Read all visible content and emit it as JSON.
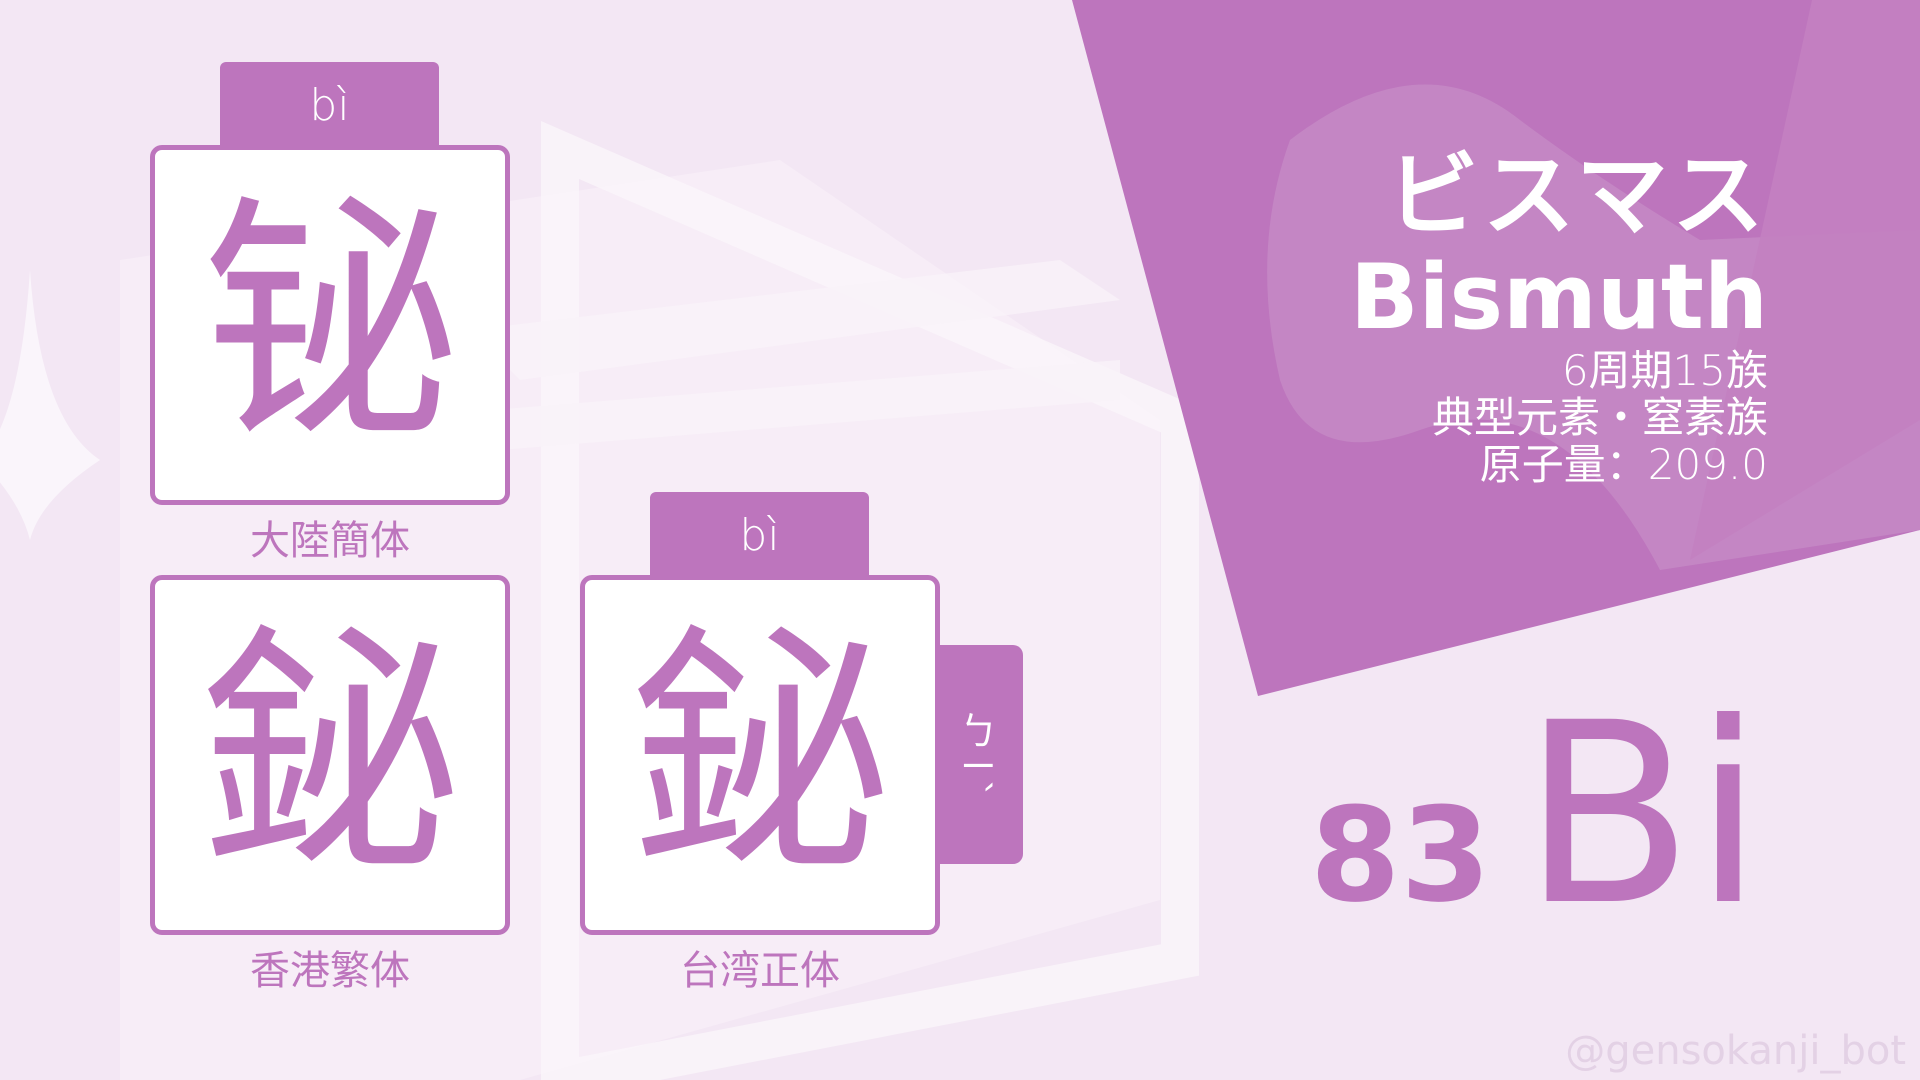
{
  "theme": {
    "accent": "#bd75bd",
    "background": "#f3e7f4",
    "card_bg": "#ffffff"
  },
  "cards": {
    "simplified": {
      "kanji": "铋",
      "pinyin": "bì",
      "label": "大陸簡体"
    },
    "hongkong": {
      "kanji": "鉍",
      "label": "香港繁体"
    },
    "taiwan": {
      "kanji": "鉍",
      "pinyin": "bì",
      "bopomofo": "ㄅㄧˋ",
      "label": "台湾正体"
    }
  },
  "element": {
    "name_ja": "ビスマス",
    "name_en": "Bismuth",
    "period_group": "6周期15族",
    "category": "典型元素・窒素族",
    "atomic_weight": "原子量：209.0",
    "atomic_number": "83",
    "symbol": "Bi"
  },
  "watermark": "@gensokanji_bot"
}
